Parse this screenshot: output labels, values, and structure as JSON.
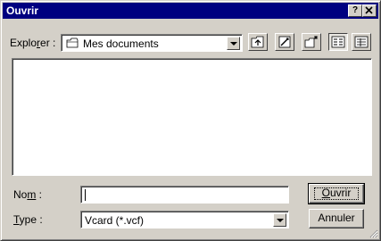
{
  "window": {
    "title": "Ouvrir",
    "help_button": "?",
    "close_button": "✕"
  },
  "look_in": {
    "label_before": "Explo",
    "label_mnemonic": "r",
    "label_after": "er :",
    "value": "Mes documents",
    "icon": "folder-icon"
  },
  "toolbar": {
    "buttons": [
      {
        "name": "up-one-level-icon"
      },
      {
        "name": "desktop-icon"
      },
      {
        "name": "new-folder-icon"
      },
      {
        "name": "list-view-icon"
      },
      {
        "name": "details-view-icon"
      }
    ]
  },
  "file_list": {
    "items": []
  },
  "file_name": {
    "label_before": "No",
    "label_mnemonic": "m",
    "label_after": " :",
    "value": ""
  },
  "file_type": {
    "label_mnemonic": "T",
    "label_after": "ype :",
    "value": "Vcard (*.vcf)"
  },
  "buttons": {
    "open_mnemonic": "O",
    "open_rest": "uvrir",
    "cancel": "Annuler"
  }
}
